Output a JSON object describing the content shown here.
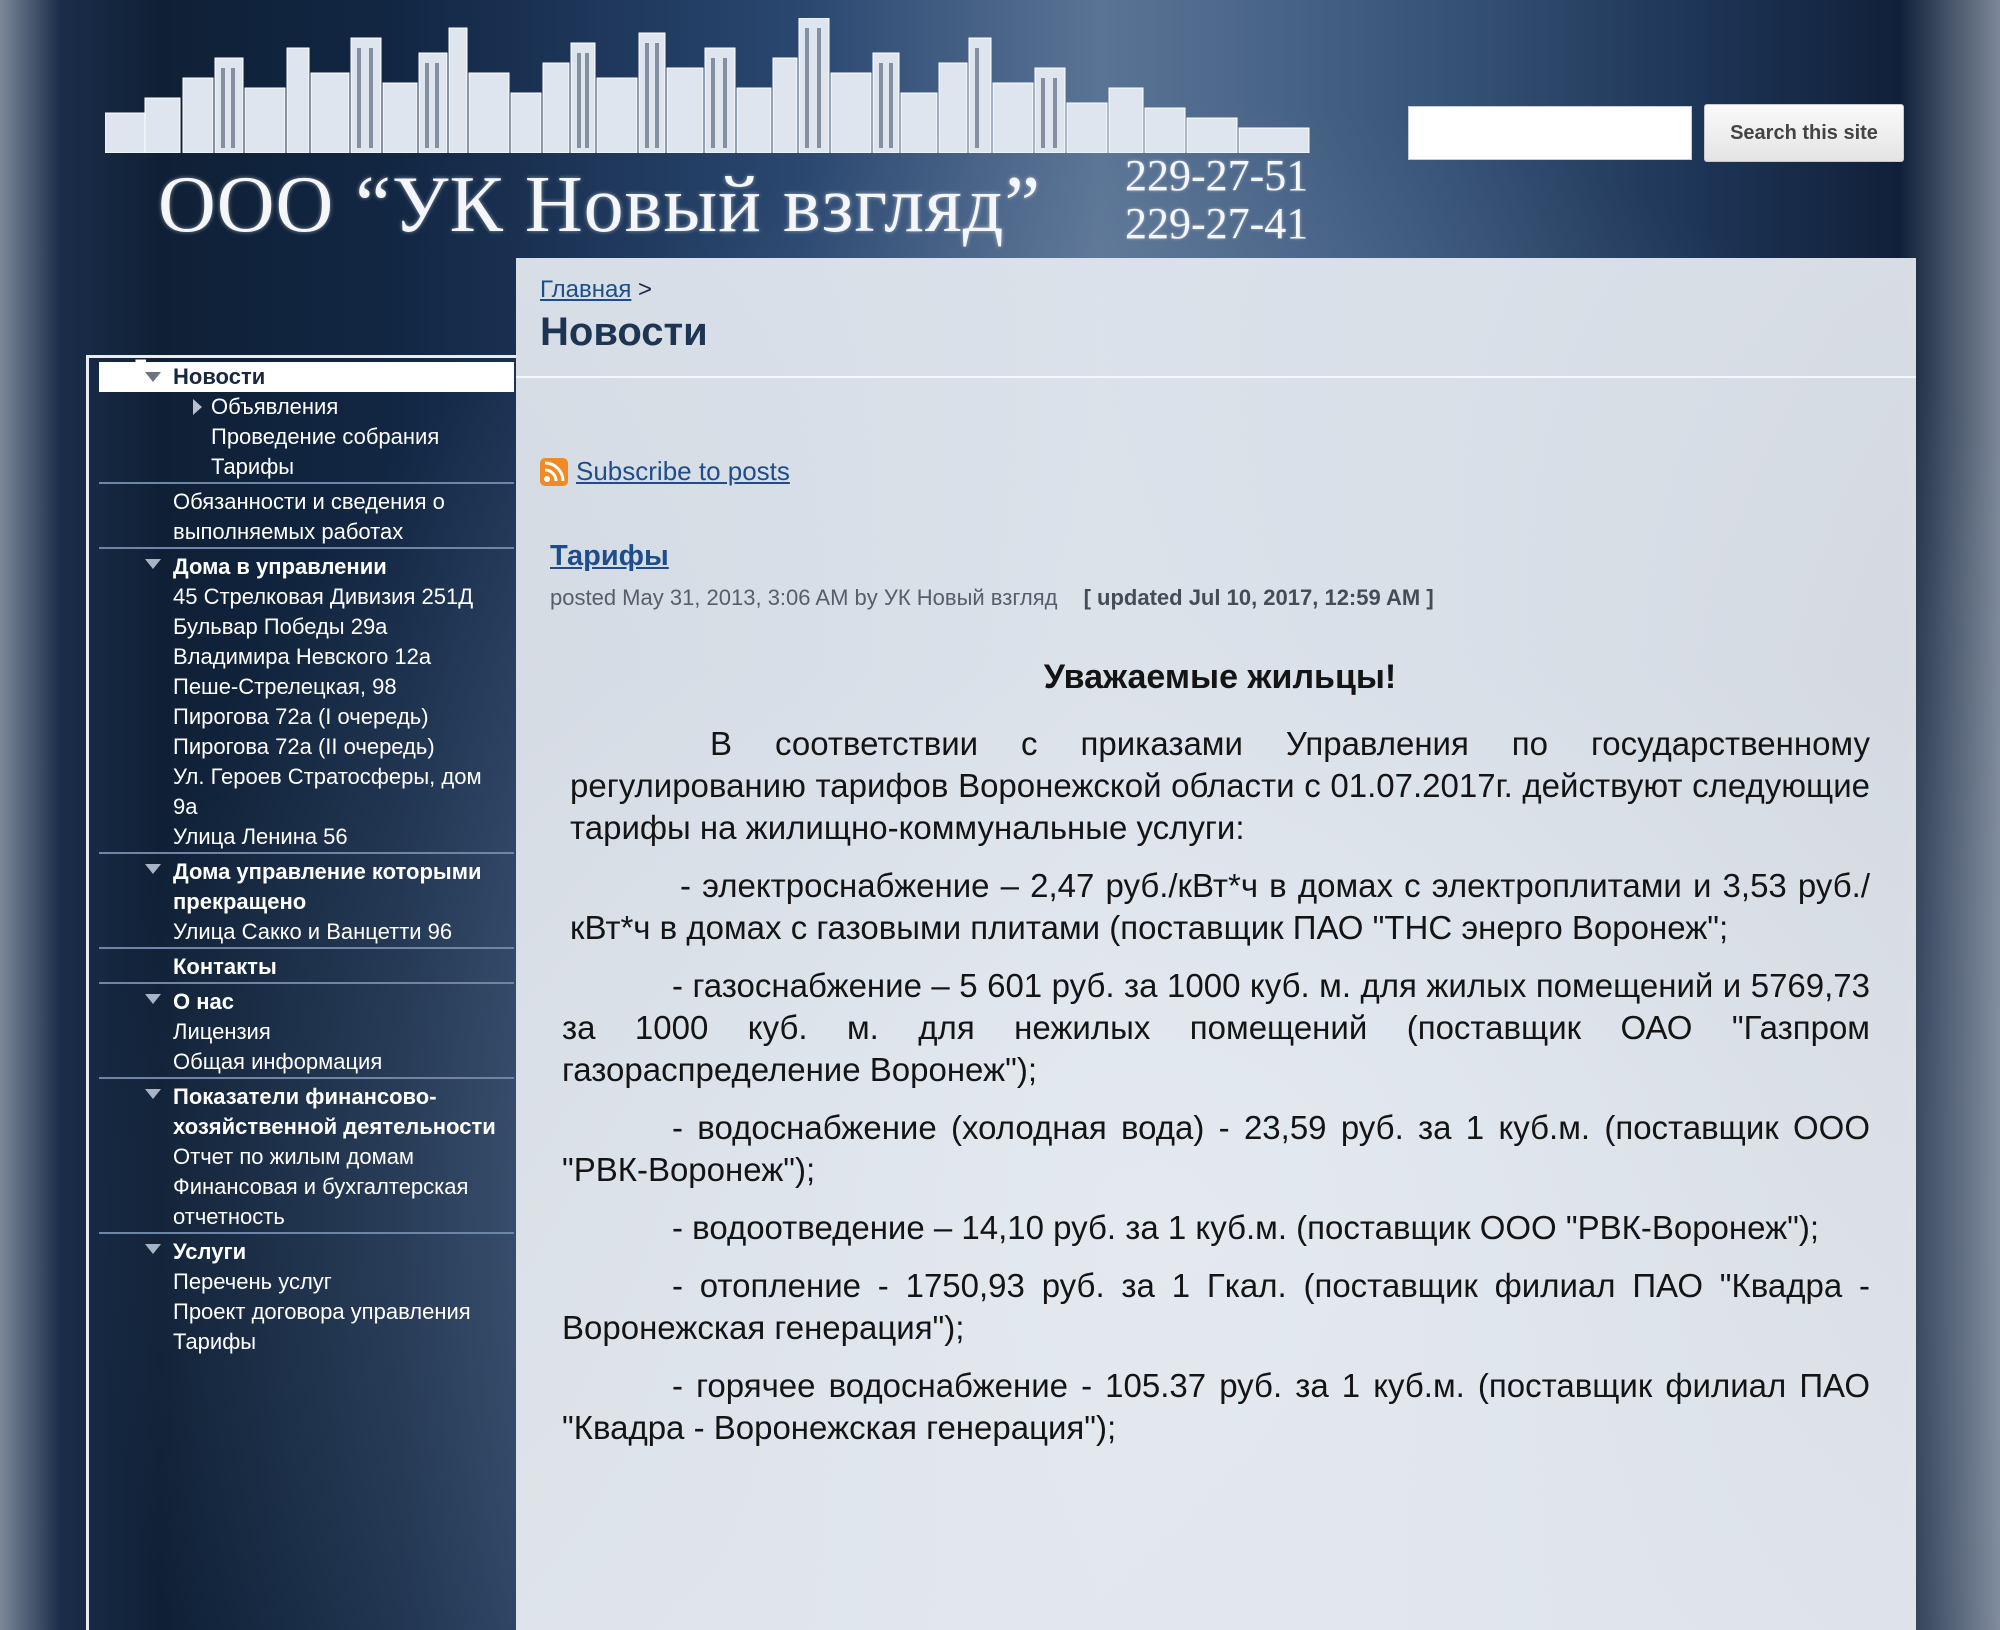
{
  "header": {
    "site_title": "ООО “УК Новый взгляд”",
    "phones": [
      "229-27-51",
      "229-27-41"
    ],
    "search": {
      "placeholder": "",
      "value": "",
      "button_label": "Search this site"
    }
  },
  "nav": {
    "root": "Главная",
    "items": [
      {
        "label": "Новости",
        "level": 1,
        "selected": true,
        "expanded": true
      },
      {
        "label": "Объявления",
        "level": 3,
        "collapsed": true
      },
      {
        "label": "Проведение собрания",
        "level": 3
      },
      {
        "label": "Тарифы",
        "level": 3
      },
      {
        "label": "Обязанности и сведения о выполняемых работах",
        "level": 2
      },
      {
        "label": "Дома в управлении",
        "level": 1,
        "expanded": true
      },
      {
        "label": "45 Стрелковая Дивизия 251Д",
        "level": 2
      },
      {
        "label": "Бульвар Победы 29а",
        "level": 2
      },
      {
        "label": "Владимира Невского 12а",
        "level": 2
      },
      {
        "label": "Пеше-Стрелецкая, 98",
        "level": 2
      },
      {
        "label": "Пирогова 72а (I очередь)",
        "level": 2
      },
      {
        "label": "Пирогова 72а (II очередь)",
        "level": 2
      },
      {
        "label": "Ул. Героев Стратосферы, дом 9а",
        "level": 2
      },
      {
        "label": "Улица Ленина 56",
        "level": 2
      },
      {
        "label": "Дома управление которыми прекращено",
        "level": 1,
        "expanded": true
      },
      {
        "label": "Улица Сакко и Ванцетти 96",
        "level": 2
      },
      {
        "label": "Контакты",
        "level": 1
      },
      {
        "label": "О нас",
        "level": 1,
        "expanded": true
      },
      {
        "label": "Лицензия",
        "level": 2
      },
      {
        "label": "Общая информация",
        "level": 2
      },
      {
        "label": "Показатели финансово-хозяйственной деятельности",
        "level": 1,
        "expanded": true
      },
      {
        "label": "Отчет по жилым домам",
        "level": 2
      },
      {
        "label": "Финансовая и бухгалтерская отчетность",
        "level": 2
      },
      {
        "label": "Услуги",
        "level": 1,
        "expanded": true
      },
      {
        "label": "Перечень услуг",
        "level": 2
      },
      {
        "label": "Проект договора управления",
        "level": 2
      },
      {
        "label": "Тарифы",
        "level": 2
      }
    ]
  },
  "content": {
    "breadcrumb_home": "Главная",
    "breadcrumb_sep": ">",
    "page_title": "Новости",
    "subscribe_label": "Subscribe to posts",
    "post": {
      "title": "Тарифы",
      "meta": "posted May 31, 2013, 3:06 AM by УК Новый взгляд",
      "updated": "[ updated Jul 10, 2017, 12:59 AM ]",
      "greeting": "Уважаемые жильцы!",
      "paragraphs": [
        "В соответствии с приказами Управления по государственному регулированию тарифов Воронежской области  с 01.07.2017г. действуют следующие тарифы на жилищно-коммунальные услуги:",
        "- электроснабжение – 2,47 руб./кВт*ч в домах с электроплитами и 3,53 руб./кВт*ч в домах с газовыми плитами (поставщик ПАО \"ТНС энерго Воронеж\";",
        "- газоснабжение – 5 601 руб. за 1000 куб. м. для жилых помещений и 5769,73 за 1000 куб. м. для нежилых помещений (поставщик ОАО \"Газпром газораспределение Воронеж\");",
        "- водоснабжение (холодная вода) - 23,59 руб. за 1 куб.м. (поставщик ООО \"РВК-Воронеж\");",
        "- водоотведение – 14,10 руб. за 1 куб.м. (поставщик ООО \"РВК-Воронеж\");",
        "- отопление - 1750,93 руб. за 1 Гкал. (поставщик филиал ПАО \"Квадра - Воронежская генерация\");",
        "- горячее водоснабжение - 105.37 руб. за 1 куб.м. (поставщик филиал ПАО \"Квадра - Воронежская генерация\");"
      ]
    }
  },
  "colors": {
    "link": "#1d4e8a",
    "page_title": "#1b3552",
    "nav_text": "#ffffff",
    "content_bg": "#e6eaf0"
  },
  "icons": {
    "rss": "rss-feed-icon",
    "logo": "city-skyline-logo"
  }
}
